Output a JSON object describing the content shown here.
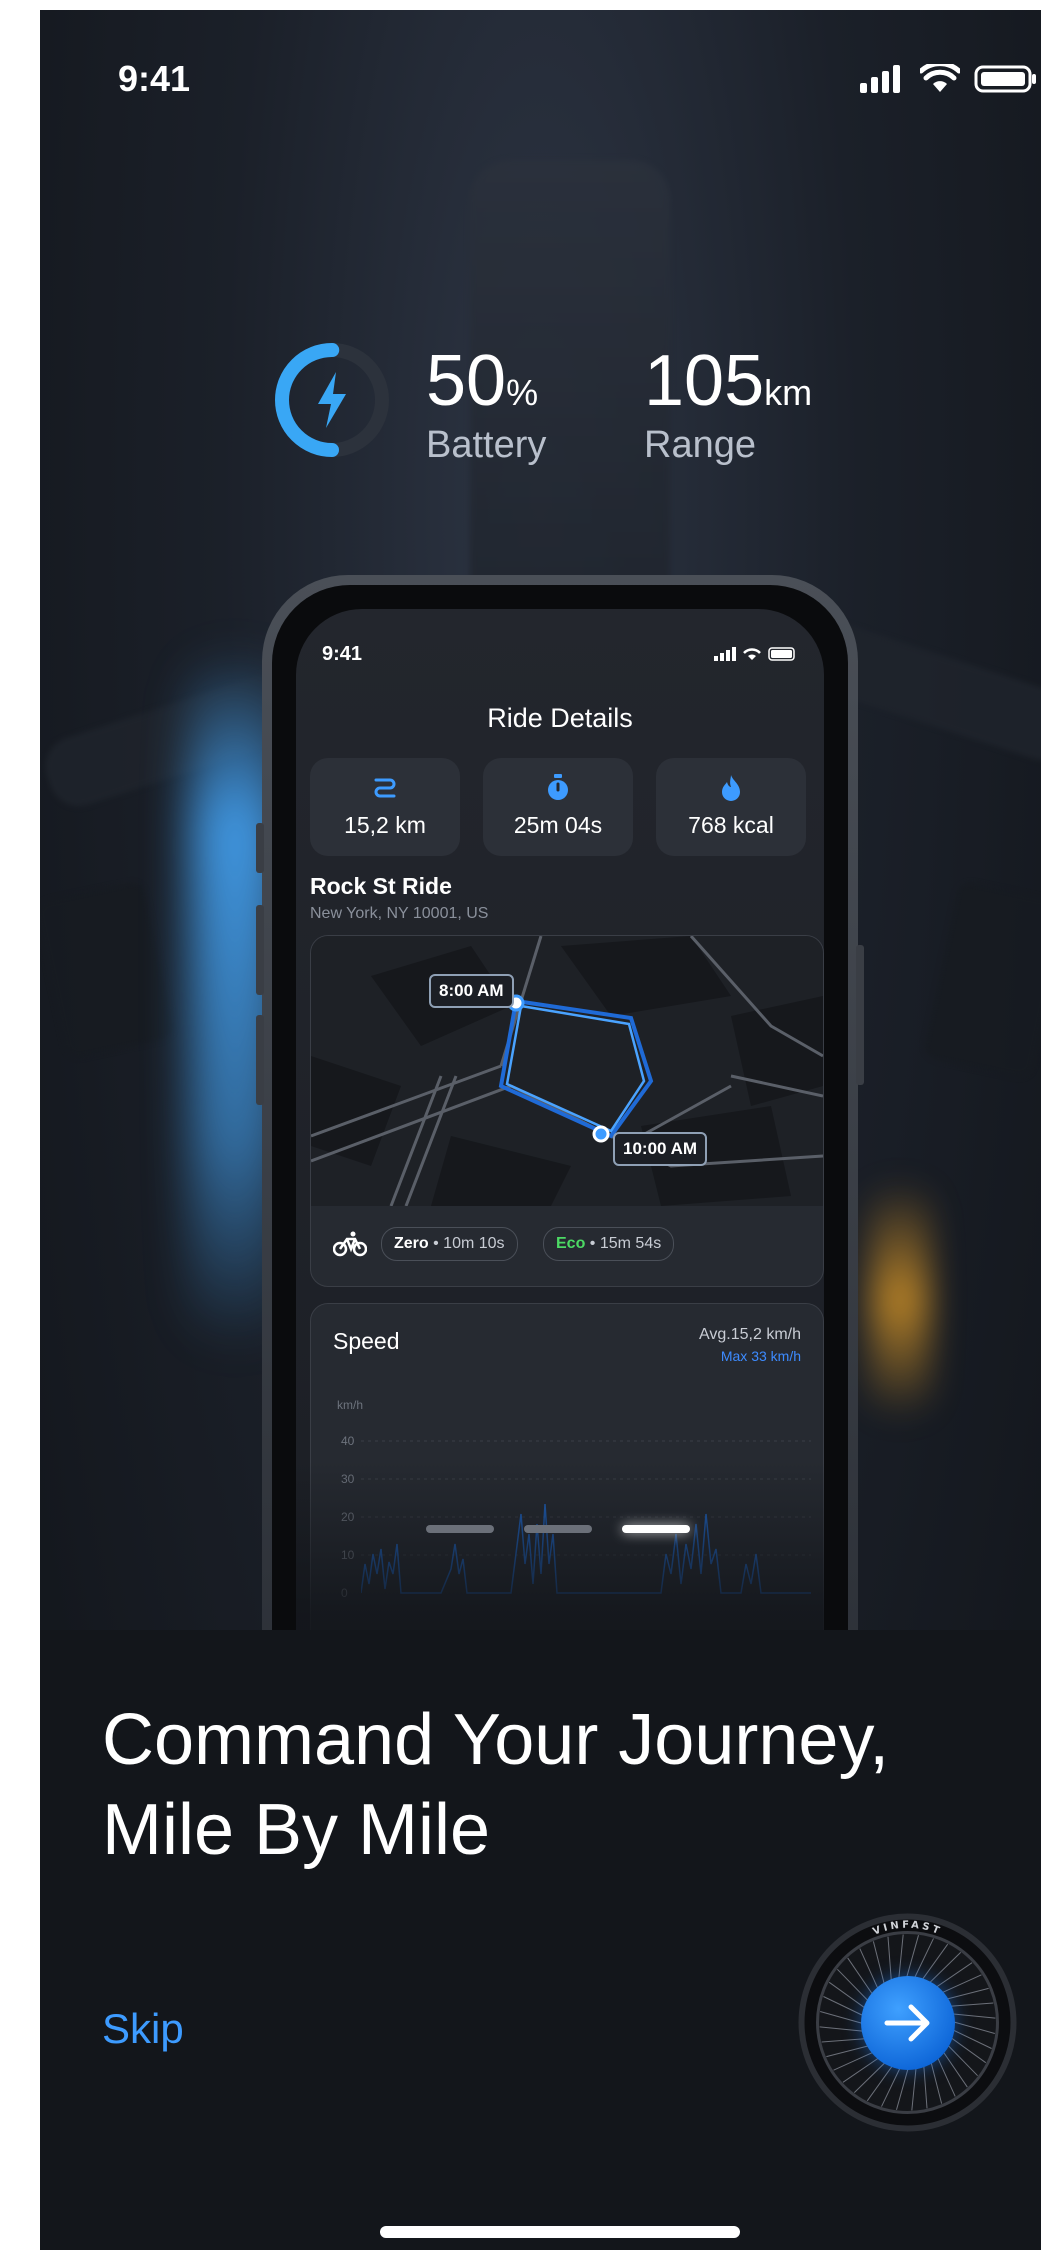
{
  "status_bar": {
    "time": "9:41"
  },
  "battery": {
    "value": "50",
    "unit": "%",
    "label": "Battery",
    "level": 0.5
  },
  "range": {
    "value": "105",
    "unit": "km",
    "label": "Range"
  },
  "phone": {
    "status_time": "9:41",
    "title": "Ride Details",
    "stats": [
      {
        "icon": "route-icon",
        "value": "15,2 km"
      },
      {
        "icon": "stopwatch-icon",
        "value": "25m 04s"
      },
      {
        "icon": "flame-icon",
        "value": "768 kcal"
      }
    ],
    "ride": {
      "name": "Rock St Ride",
      "address": "New York, NY 10001, US"
    },
    "map": {
      "start_time": "8:00 AM",
      "end_time": "10:00 AM"
    },
    "modes": [
      {
        "name": "Zero",
        "duration": "10m 10s",
        "color": "#ffffff"
      },
      {
        "name": "Eco",
        "duration": "15m 54s",
        "color": "#4cd964"
      }
    ],
    "speed": {
      "title": "Speed",
      "avg": "Avg.15,2 km/h",
      "max": "Max 33 km/h",
      "unit": "km/h",
      "y_ticks": [
        "40",
        "30",
        "20",
        "10",
        "0"
      ]
    }
  },
  "carousel": {
    "count": 3,
    "active": 2
  },
  "headline": {
    "line1": "Command Your Journey,",
    "line2": "Mile By Mile"
  },
  "skip_label": "Skip",
  "brand": "VINFAST",
  "colors": {
    "accent": "#3d9bff",
    "background": "#13161b",
    "eco": "#4cd964"
  }
}
